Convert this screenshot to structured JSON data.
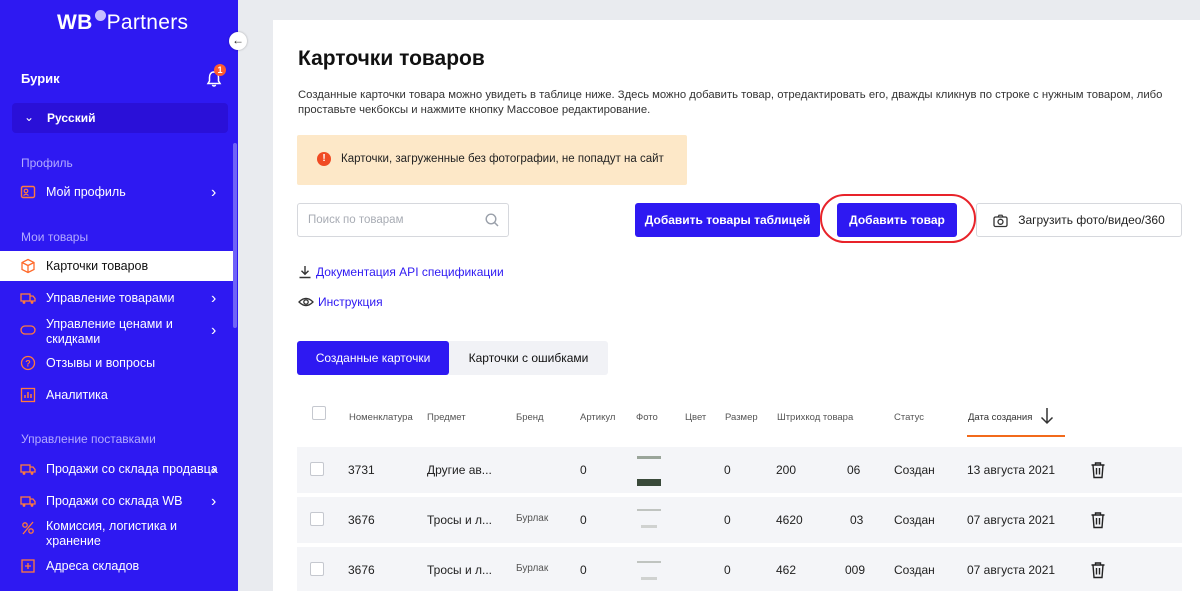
{
  "sidebar": {
    "logo_wb": "WB",
    "logo_partners": "Partners",
    "user_name": "Бурик",
    "notification_count": "1",
    "language": "Русский",
    "sections": {
      "profile": "Профиль",
      "my_goods": "Мои товары",
      "supply": "Управление поставками"
    },
    "items": [
      {
        "label": "Мой профиль",
        "icon": "user-card-icon"
      },
      {
        "label": "Карточки товаров",
        "icon": "box-icon"
      },
      {
        "label": "Управление товарами",
        "icon": "truck-icon"
      },
      {
        "label": "Управление ценами и скидками",
        "icon": "price-tag-icon"
      },
      {
        "label": "Отзывы и вопросы",
        "icon": "question-icon"
      },
      {
        "label": "Аналитика",
        "icon": "analytics-icon"
      },
      {
        "label": "Продажи со склада продавца",
        "icon": "truck-icon"
      },
      {
        "label": "Продажи со склада WB",
        "icon": "truck-icon"
      },
      {
        "label": "Комиссия, логистика и хранение",
        "icon": "commission-icon"
      },
      {
        "label": "Адреса складов",
        "icon": "location-icon"
      }
    ]
  },
  "main": {
    "title": "Карточки товаров",
    "description": "Созданные карточки товара можно увидеть в таблице ниже. Здесь можно добавить товар, отредактировать его, дважды кликнув по строке с нужным товаром, либо проставьте чекбоксы и нажмите кнопку Массовое редактирование.",
    "alert": "Карточки, загруженные без фотографии, не попадут на сайт",
    "search_placeholder": "Поиск по товарам",
    "btn_add_table": "Добавить товары таблицей",
    "btn_add": "Добавить товар",
    "btn_upload": "Загрузить фото/видео/360",
    "link_api": "Документация API спецификации",
    "link_instruction": "Инструкция",
    "tabs": [
      "Созданные карточки",
      "Карточки с ошибками"
    ]
  },
  "table": {
    "headers": [
      "Номенклатура",
      "Предмет",
      "Бренд",
      "Артикул",
      "Фото",
      "Цвет",
      "Размер",
      "Штрихкод товара",
      "Статус",
      "Дата создания"
    ],
    "rows": [
      {
        "nomenclature": "3731",
        "subject": "Другие ав...",
        "brand": "",
        "article": "0",
        "size": "0",
        "barcode": "200",
        "barcode_end": "06",
        "status": "Создан",
        "date": "13 августа 2021"
      },
      {
        "nomenclature": "3676",
        "subject": "Тросы и л...",
        "brand": "Бурлак",
        "article": "0",
        "size": "0",
        "barcode": "4620",
        "barcode_end": "03",
        "status": "Создан",
        "date": "07 августа 2021"
      },
      {
        "nomenclature": "3676",
        "subject": "Тросы и л...",
        "brand": "Бурлак",
        "article": "0",
        "size": "0",
        "barcode": "462",
        "barcode_end": "009",
        "status": "Создан",
        "date": "07 августа 2021"
      }
    ]
  }
}
